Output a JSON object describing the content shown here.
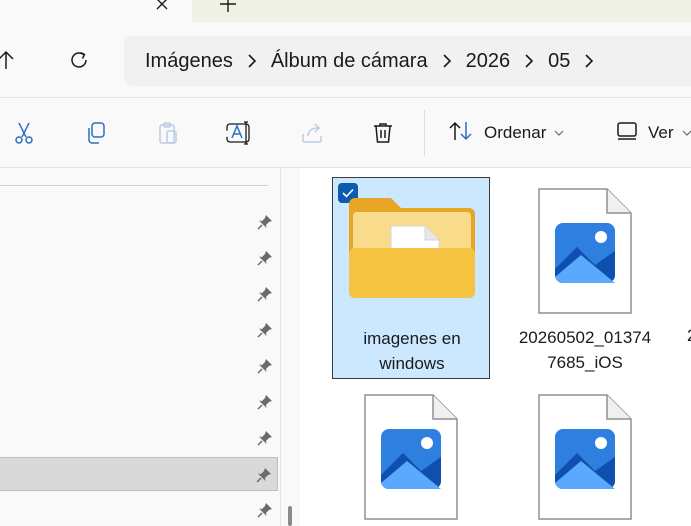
{
  "breadcrumb": {
    "items": [
      "Imágenes",
      "Álbum de cámara",
      "2026",
      "05"
    ]
  },
  "toolbar": {
    "sort_label": "Ordenar",
    "view_label": "Ver"
  },
  "files": [
    {
      "name_line1": "imagenes en",
      "name_line2": "windows",
      "type": "folder",
      "selected": true
    },
    {
      "name_line1": "20260502_01374",
      "name_line2": "7685_iOS",
      "type": "image",
      "selected": false
    },
    {
      "name_line1": "",
      "name_line2": "",
      "type": "image",
      "selected": false
    },
    {
      "name_line1": "",
      "name_line2": "",
      "type": "image",
      "selected": false
    }
  ],
  "partial_file_label": "2",
  "colors": {
    "accent": "#0b5cad",
    "selection": "#cce8ff",
    "folder": "#f5c242",
    "photo_sky": "#2f7fe0"
  },
  "icons": {
    "cut": "scissors-icon",
    "copy": "copy-icon",
    "paste": "clipboard-icon",
    "rename": "rename-icon",
    "share": "share-icon",
    "delete": "trash-icon",
    "sort": "sort-arrows-icon",
    "view": "view-icon"
  }
}
